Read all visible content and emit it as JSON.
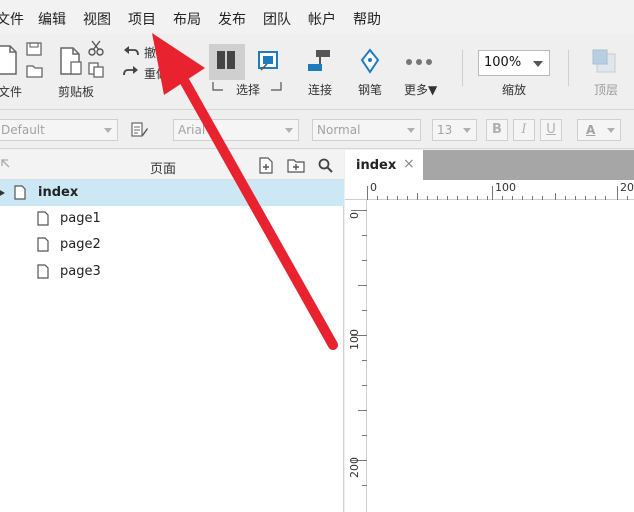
{
  "menu": {
    "items": [
      "文件",
      "编辑",
      "视图",
      "项目",
      "布局",
      "发布",
      "团队",
      "帐户",
      "帮助"
    ]
  },
  "toolbar": {
    "file_label": "文件",
    "clipboard_label": "剪贴板",
    "undo_label": "撤销",
    "redo_label": "重做",
    "select_label": "选择",
    "connect_label": "连接",
    "pen_label": "钢笔",
    "more_label": "更多▼",
    "zoom_value": "100%",
    "zoom_label": "缩放",
    "top_layer_label": "顶层"
  },
  "formatbar": {
    "style_value": "Default",
    "font_value": "Arial",
    "weight_value": "Normal",
    "size_value": "13",
    "bold": "B",
    "italic": "I",
    "underline": "U",
    "font_color": "A"
  },
  "pages": {
    "title": "页面",
    "items": [
      {
        "label": "index"
      },
      {
        "label": "page1"
      },
      {
        "label": "page2"
      },
      {
        "label": "page3"
      }
    ]
  },
  "canvas": {
    "tab_label": "index",
    "tab_close": "×",
    "ruler_h": [
      "0",
      "100",
      "20"
    ],
    "ruler_v": [
      "0",
      "100",
      "200"
    ]
  },
  "colors": {
    "selected_row": "#cde8f5",
    "arrow": "#e8232f",
    "accent_blue": "#1e7bbd"
  }
}
